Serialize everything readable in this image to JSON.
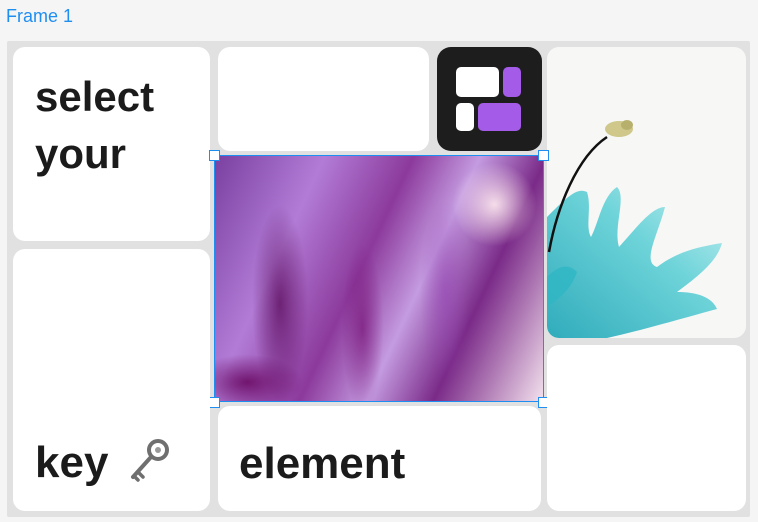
{
  "frame": {
    "label": "Frame 1"
  },
  "cards": {
    "select_your": "select\nyour",
    "key": "key",
    "element": "element"
  },
  "icons": {
    "key": "key-icon",
    "logo": "layout-blocks-logo"
  },
  "colors": {
    "accent": "#1f8ef1",
    "logo_bg": "#1d1d1d",
    "logo_purple": "#a35be8",
    "card_bg": "#ffffff",
    "frame_bg": "#e1e1e1"
  }
}
